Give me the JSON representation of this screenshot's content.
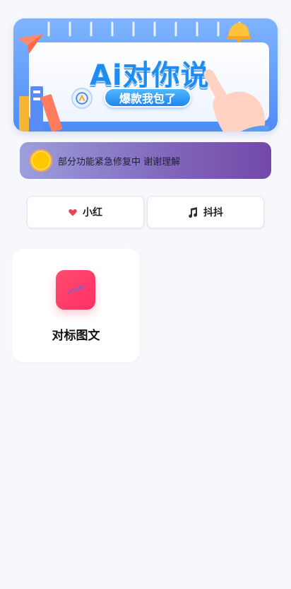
{
  "banner": {
    "title": "Ai对你说",
    "button": "爆款我包了"
  },
  "notice": {
    "text": "部分功能紧急修复中 谢谢理解",
    "icon": "sun-icon"
  },
  "tabs": [
    {
      "label": "小红",
      "icon": "heart-icon",
      "icon_color": "#e8435a"
    },
    {
      "label": "抖抖",
      "icon": "music-note-icon",
      "icon_color": "#3a2b2b"
    }
  ],
  "tools": [
    {
      "label": "对标图文",
      "icon": "trend-chart-icon",
      "icon_bg": "#ff3b69"
    }
  ]
}
